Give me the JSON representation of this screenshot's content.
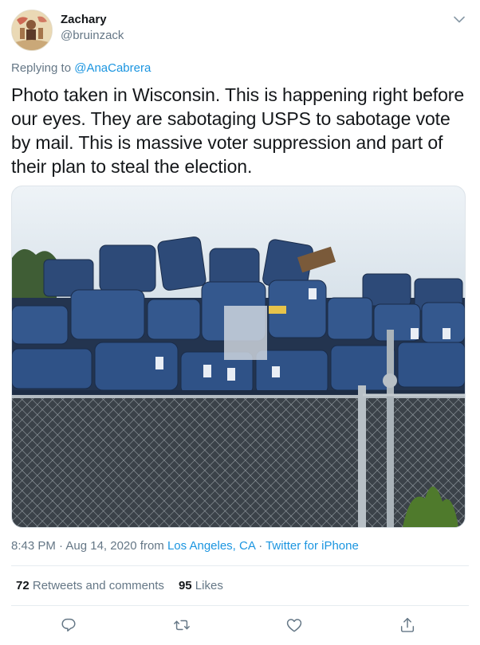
{
  "author": {
    "display_name": "Zachary",
    "handle": "@bruinzack"
  },
  "reply": {
    "prefix": "Replying to ",
    "mention": "@AnaCabrera"
  },
  "tweet": {
    "text": "Photo taken in Wisconsin. This is happening right before our eyes. They are sabotaging USPS to sabotage vote by mail. This is massive voter suppression and part of their plan to steal the election."
  },
  "meta": {
    "time_date": "8:43 PM · Aug 14, 2020 from ",
    "location": "Los Angeles, CA",
    "separator": " · ",
    "client": "Twitter for iPhone"
  },
  "stats": {
    "retweets_count": "72",
    "retweets_label": "Retweets and comments",
    "likes_count": "95",
    "likes_label": "Likes"
  },
  "icons": {
    "caret": "chevron-down-icon",
    "reply": "reply-icon",
    "retweet": "retweet-icon",
    "like": "heart-icon",
    "share": "share-icon"
  },
  "colors": {
    "link": "#1b95e0",
    "secondary_text": "#657786",
    "primary_text": "#14171a",
    "mailbox_blue": "#2d4a78"
  }
}
